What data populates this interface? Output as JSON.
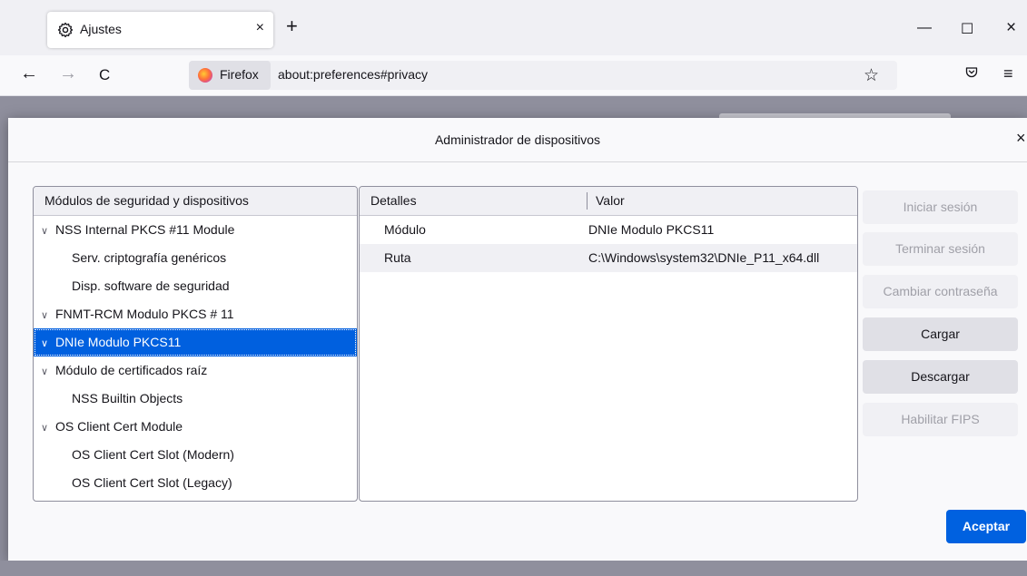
{
  "browser": {
    "tab": {
      "icon": "gear-icon",
      "title": "Ajustes",
      "close": "×"
    },
    "new_tab": "+",
    "window_controls": {
      "minimize": "—",
      "maximize": "☐",
      "close": "×"
    },
    "nav": {
      "back": "←",
      "forward": "→",
      "reload": "C"
    },
    "url": {
      "identity": "Firefox",
      "address": "about:preferences#privacy"
    },
    "star": "☆",
    "menu": "≡"
  },
  "dialog": {
    "title": "Administrador de dispositivos",
    "close": "×",
    "tree": {
      "header": "Módulos de seguridad y dispositivos",
      "rows": [
        {
          "label": "NSS Internal PKCS #11 Module",
          "level": "parent"
        },
        {
          "label": "Serv. criptografía genéricos",
          "level": "child"
        },
        {
          "label": "Disp. software de seguridad",
          "level": "child"
        },
        {
          "label": "FNMT-RCM Modulo PKCS # 11",
          "level": "parent"
        },
        {
          "label": "DNIe Modulo PKCS11",
          "level": "parent",
          "selected": true
        },
        {
          "label": "Módulo de certificados raíz",
          "level": "parent"
        },
        {
          "label": "NSS Builtin Objects",
          "level": "child"
        },
        {
          "label": "OS Client Cert Module",
          "level": "parent"
        },
        {
          "label": "OS Client Cert Slot (Modern)",
          "level": "child"
        },
        {
          "label": "OS Client Cert Slot (Legacy)",
          "level": "child"
        }
      ]
    },
    "details": {
      "col1": "Detalles",
      "col2": "Valor",
      "rows": [
        {
          "key": "Módulo",
          "value": "DNIe Modulo PKCS11"
        },
        {
          "key": "Ruta",
          "value": "C:\\Windows\\system32\\DNIe_P11_x64.dll"
        }
      ]
    },
    "buttons": {
      "login": "Iniciar sesión",
      "logout": "Terminar sesión",
      "change_password": "Cambiar contraseña",
      "load": "Cargar",
      "unload": "Descargar",
      "fips": "Habilitar FIPS"
    },
    "accept": "Aceptar"
  },
  "colors": {
    "accent": "#0061e0",
    "selection": "#0060df",
    "disabled_text": "#a0a0a8"
  }
}
